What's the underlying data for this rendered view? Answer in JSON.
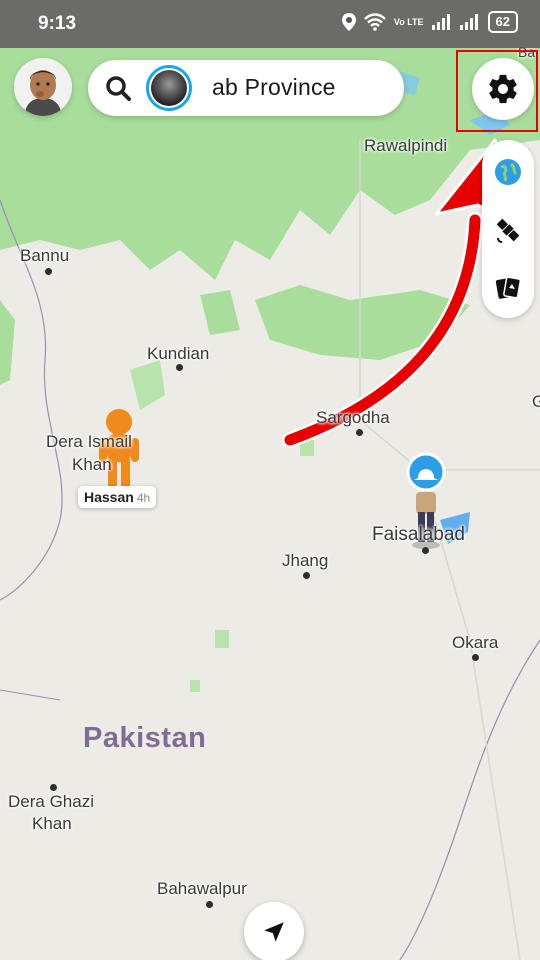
{
  "status_bar": {
    "time": "9:13",
    "volte": "Vo LTE",
    "battery": "62"
  },
  "top_bar": {
    "location_text": "ab Province"
  },
  "map": {
    "places": {
      "rawalpindi": "Rawalpindi",
      "bannu": "Bannu",
      "kundian": "Kundian",
      "dera_ismail_khan_line1": "Dera Ismail",
      "dera_ismail_khan_line2": "Khan",
      "sargodha": "Sargodha",
      "faisalabad": "Faisalabad",
      "jhang": "Jhang",
      "okara": "Okara",
      "country": "Pakistan",
      "dera_ghazi_khan_line1": "Dera Ghazi",
      "dera_ghazi_khan_line2": "Khan",
      "bahawalpur": "Bahawalpur",
      "edge_top": "Ba",
      "edge_right": "G"
    },
    "friend": {
      "name": "Hassan",
      "time_ago": "4h"
    }
  },
  "colors": {
    "highlight": "#e60000",
    "story_ring": "#1aa6e8",
    "greenery": "#a8dd9b",
    "land": "#ecebe6"
  },
  "icons": {
    "search": "search-icon",
    "settings": "gear-icon",
    "globe": "globe-icon",
    "satellite": "satellite-icon",
    "cards": "map-cards-icon",
    "recenter": "navigation-arrow-icon"
  }
}
